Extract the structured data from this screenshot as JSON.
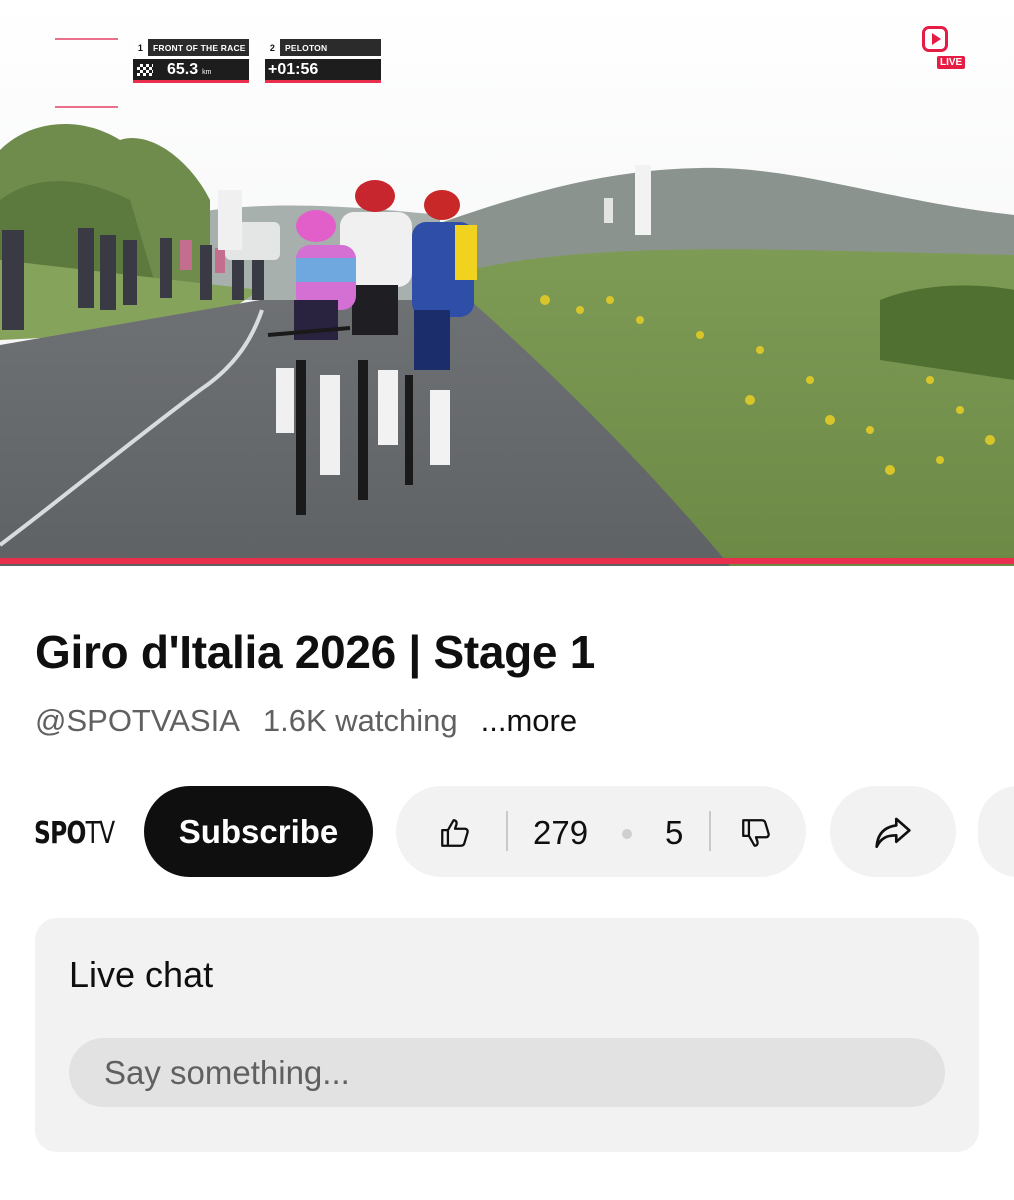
{
  "video": {
    "graphic": {
      "front": {
        "position": "1",
        "label": "FRONT OF THE RACE",
        "distance": "65.3",
        "unit": "km"
      },
      "peloton": {
        "position": "2",
        "label": "PELOTON",
        "gap": "+01:56"
      }
    },
    "live_badge": "LIVE",
    "progress_percent": 100
  },
  "info": {
    "title": "Giro d'Italia 2026 | Stage 1",
    "channel_handle": "@SPOTVASIA",
    "watching": "1.6K watching",
    "more_label": "...more"
  },
  "actions": {
    "channel_logo_main": "SPO",
    "channel_logo_tail": "TV",
    "subscribe_label": "Subscribe",
    "like_count": "279",
    "dislike_count": "5",
    "icons": [
      "thumbs-up-icon",
      "thumbs-down-icon",
      "share-icon"
    ]
  },
  "live_chat": {
    "title": "Live chat",
    "placeholder": "Say something..."
  },
  "colors": {
    "accent_red": "#e8304e",
    "live_red": "#e51c44",
    "pill_background": "#f2f2f2",
    "subscribe_background": "#0f0f0f"
  }
}
